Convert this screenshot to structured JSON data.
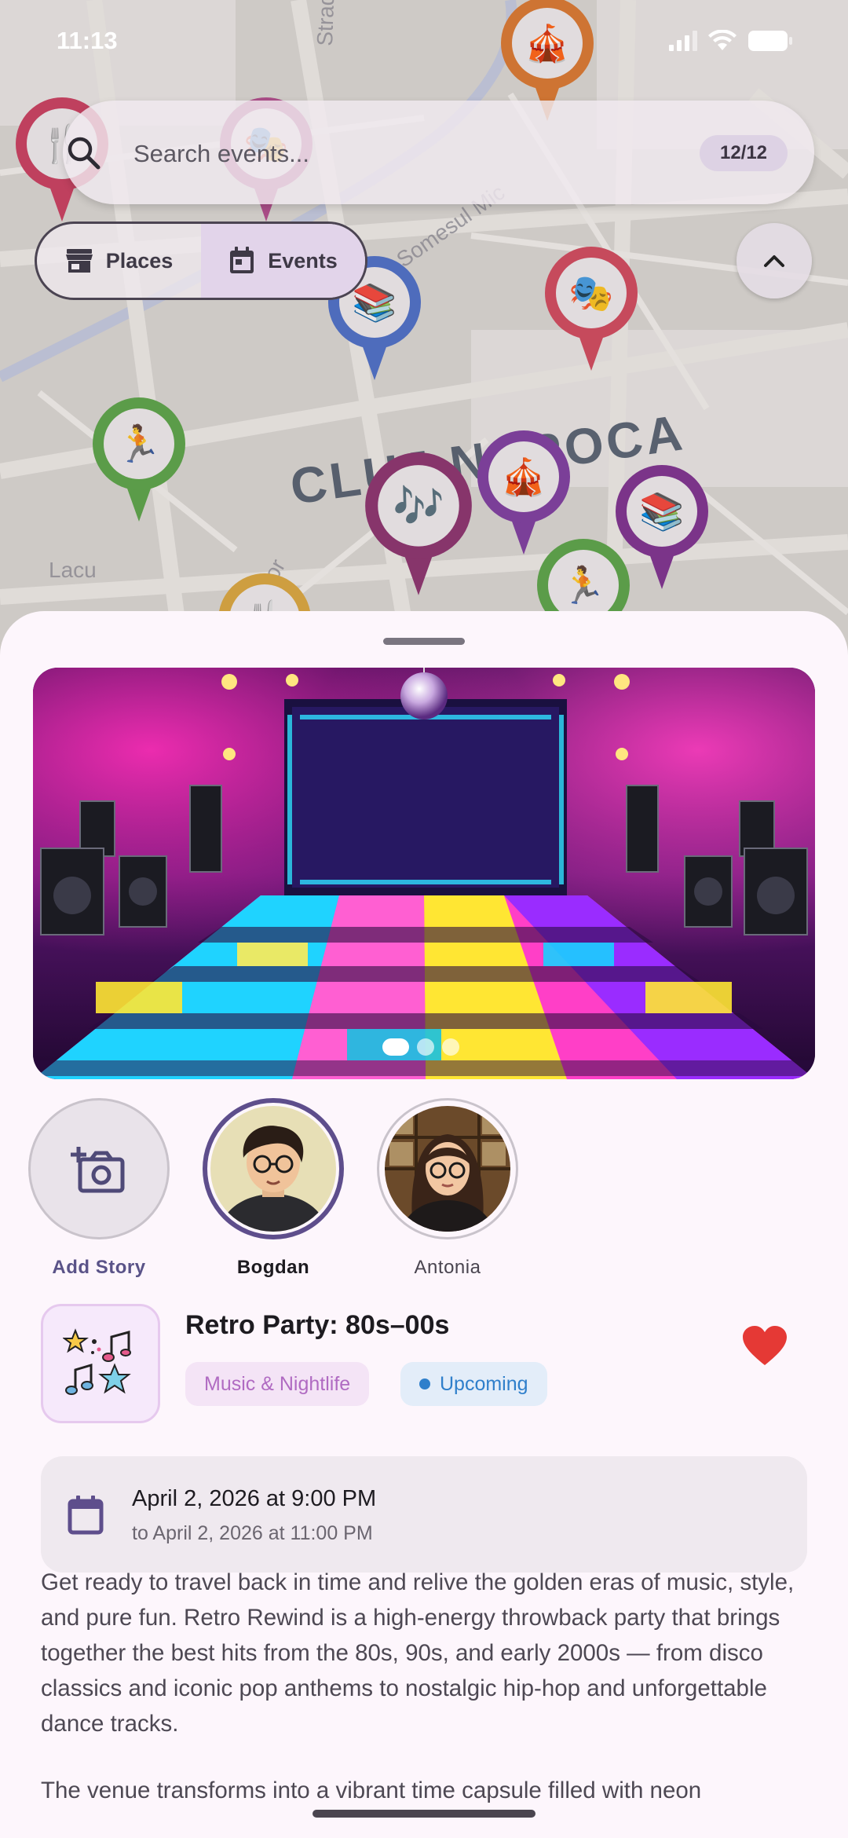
{
  "status_bar": {
    "time": "11:13"
  },
  "map": {
    "city_label": "CLUJ NAPOCA",
    "streets": [
      "Strada Horea",
      "Somesul Mic",
      "Lacu",
      "dor"
    ]
  },
  "search": {
    "placeholder": "Search events...",
    "count": "12/12"
  },
  "segmented": {
    "places_label": "Places",
    "events_label": "Events",
    "active": "Events"
  },
  "hero": {
    "slides": 3,
    "active_slide": 1
  },
  "stories": {
    "add_label": "Add Story",
    "items": [
      {
        "name": "Bogdan",
        "seen": false
      },
      {
        "name": "Antonia",
        "seen": true
      }
    ]
  },
  "event": {
    "title": "Retro Party: 80s–00s",
    "category": "Music & Nightlife",
    "status": "Upcoming",
    "favorite": true,
    "date_main": "April 2, 2026 at 9:00 PM",
    "date_sub": "to April 2, 2026 at 11:00 PM",
    "description": [
      "Get ready to travel back in time and relive the golden eras of music, style, and pure fun. Retro Rewind is a high-energy throwback party that brings together the best hits from the 80s, 90s, and early 2000s — from disco classics and iconic pop anthems to nostalgic hip-hop and unforgettable dance tracks.",
      "The venue transforms into a vibrant time capsule filled with neon"
    ]
  },
  "colors": {
    "accent": "#5e4e8c",
    "favorite": "#e53935",
    "category_chip": "#b06bc2",
    "status_chip": "#2f7fcb",
    "sheet_bg": "#fdf6fc"
  },
  "icons": {
    "search": "search-icon",
    "places": "storefront-icon",
    "events": "calendar-icon",
    "collapse": "chevron-up-icon",
    "add_story": "add-photo-icon",
    "favorite": "heart-icon",
    "date": "calendar-icon"
  }
}
